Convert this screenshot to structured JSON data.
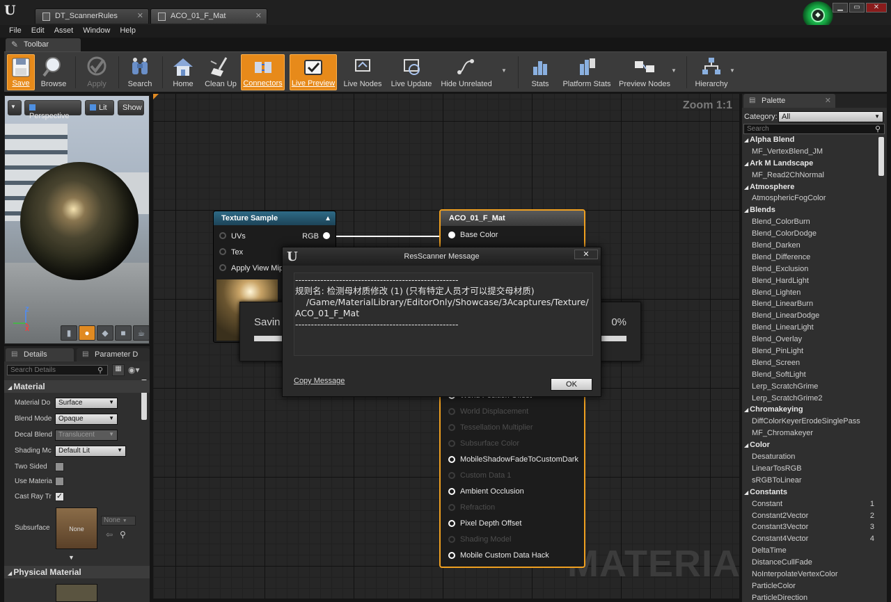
{
  "window": {
    "tabs": [
      {
        "label": "DT_ScannerRules"
      },
      {
        "label": "ACO_01_F_Mat"
      }
    ]
  },
  "menu": [
    "File",
    "Edit",
    "Asset",
    "Window",
    "Help"
  ],
  "toolbar": {
    "tab_label": "Toolbar",
    "buttons": {
      "save": "Save",
      "browse": "Browse",
      "apply": "Apply",
      "search": "Search",
      "home": "Home",
      "clean_up": "Clean Up",
      "connectors": "Connectors",
      "live_preview": "Live Preview",
      "live_nodes": "Live Nodes",
      "live_update": "Live Update",
      "hide_unrelated": "Hide Unrelated",
      "stats": "Stats",
      "platform_stats": "Platform Stats",
      "preview_nodes": "Preview Nodes",
      "hierarchy": "Hierarchy"
    },
    "active": [
      "save",
      "connectors",
      "live_preview"
    ],
    "accent_color": "#e78a1a"
  },
  "viewport": {
    "view_mode": "Perspective",
    "lighting": "Lit",
    "show": "Show",
    "axes": {
      "z": "Z",
      "x": "X"
    }
  },
  "details": {
    "tabs": [
      "Details",
      "Parameter D"
    ],
    "search_placeholder": "Search Details",
    "section_material": "Material",
    "rows": [
      {
        "label": "Material Do",
        "value": "Surface"
      },
      {
        "label": "Blend Mode",
        "value": "Opaque"
      },
      {
        "label": "Decal Blend",
        "value": "Translucent"
      },
      {
        "label": "Shading Mc",
        "value": "Default Lit"
      },
      {
        "label": "Two Sided",
        "checked": false
      },
      {
        "label": "Use Materia",
        "checked": false
      },
      {
        "label": "Cast Ray Tr",
        "checked": true
      },
      {
        "label": "Subsurface",
        "thumb": "None",
        "combo": "None"
      }
    ],
    "section_physical": "Physical Material"
  },
  "graph": {
    "zoom": "Zoom 1:1",
    "watermark": "MATERIAL",
    "texture_node": {
      "title": "Texture Sample",
      "inputs": [
        "UVs",
        "Tex",
        "Apply View Mip"
      ],
      "output": "RGB"
    },
    "material_node": {
      "title": "ACO_01_F_Mat",
      "pins": [
        {
          "label": "Base Color",
          "state": "connected"
        },
        {
          "label": "World Position Offset",
          "state": "on"
        },
        {
          "label": "World Displacement",
          "state": "dim"
        },
        {
          "label": "Tessellation Multiplier",
          "state": "dim"
        },
        {
          "label": "Subsurface Color",
          "state": "dim"
        },
        {
          "label": "MobileShadowFadeToCustomDark",
          "state": "on"
        },
        {
          "label": "Custom Data 1",
          "state": "dim"
        },
        {
          "label": "Ambient Occlusion",
          "state": "on"
        },
        {
          "label": "Refraction",
          "state": "dim"
        },
        {
          "label": "Pixel Depth Offset",
          "state": "on"
        },
        {
          "label": "Shading Model",
          "state": "dim"
        },
        {
          "label": "Mobile Custom Data Hack",
          "state": "on"
        }
      ]
    },
    "saving": {
      "text": "Savin",
      "percent": "0%"
    }
  },
  "dialog": {
    "title": "ResScanner Message",
    "body": "----------------------------------------------------\n规则名: 检测母材质修改 (1) (只有特定人员才可以提交母材质)\n    /Game/MaterialLibrary/EditorOnly/Showcase/3Acaptures/Texture/\nACO_01_F_Mat\n----------------------------------------------------",
    "copy_label": "Copy Message",
    "ok_label": "OK"
  },
  "palette": {
    "tab": "Palette",
    "category_label": "Category:",
    "category_value": "All",
    "search_placeholder": "Search",
    "items": [
      {
        "type": "cat",
        "label": "Alpha Blend"
      },
      {
        "type": "leaf",
        "label": "MF_VertexBlend_JM"
      },
      {
        "type": "cat",
        "label": "Ark M Landscape"
      },
      {
        "type": "leaf",
        "label": "MF_Read2ChNormal"
      },
      {
        "type": "cat",
        "label": "Atmosphere"
      },
      {
        "type": "leaf",
        "label": "AtmosphericFogColor"
      },
      {
        "type": "cat",
        "label": "Blends"
      },
      {
        "type": "leaf",
        "label": "Blend_ColorBurn"
      },
      {
        "type": "leaf",
        "label": "Blend_ColorDodge"
      },
      {
        "type": "leaf",
        "label": "Blend_Darken"
      },
      {
        "type": "leaf",
        "label": "Blend_Difference"
      },
      {
        "type": "leaf",
        "label": "Blend_Exclusion"
      },
      {
        "type": "leaf",
        "label": "Blend_HardLight"
      },
      {
        "type": "leaf",
        "label": "Blend_Lighten"
      },
      {
        "type": "leaf",
        "label": "Blend_LinearBurn"
      },
      {
        "type": "leaf",
        "label": "Blend_LinearDodge"
      },
      {
        "type": "leaf",
        "label": "Blend_LinearLight"
      },
      {
        "type": "leaf",
        "label": "Blend_Overlay"
      },
      {
        "type": "leaf",
        "label": "Blend_PinLight"
      },
      {
        "type": "leaf",
        "label": "Blend_Screen"
      },
      {
        "type": "leaf",
        "label": "Blend_SoftLight"
      },
      {
        "type": "leaf",
        "label": "Lerp_ScratchGrime"
      },
      {
        "type": "leaf",
        "label": "Lerp_ScratchGrime2"
      },
      {
        "type": "cat",
        "label": "Chromakeying"
      },
      {
        "type": "leaf",
        "label": "DiffColorKeyerErodeSinglePass"
      },
      {
        "type": "leaf",
        "label": "MF_Chromakeyer"
      },
      {
        "type": "cat",
        "label": "Color"
      },
      {
        "type": "leaf",
        "label": "Desaturation"
      },
      {
        "type": "leaf",
        "label": "LinearTosRGB"
      },
      {
        "type": "leaf",
        "label": "sRGBToLinear"
      },
      {
        "type": "cat",
        "label": "Constants"
      },
      {
        "type": "leaf",
        "label": "Constant",
        "hotkey": "1"
      },
      {
        "type": "leaf",
        "label": "Constant2Vector",
        "hotkey": "2"
      },
      {
        "type": "leaf",
        "label": "Constant3Vector",
        "hotkey": "3"
      },
      {
        "type": "leaf",
        "label": "Constant4Vector",
        "hotkey": "4"
      },
      {
        "type": "leaf",
        "label": "DeltaTime"
      },
      {
        "type": "leaf",
        "label": "DistanceCullFade"
      },
      {
        "type": "leaf",
        "label": "NoInterpolateVertexColor"
      },
      {
        "type": "leaf",
        "label": "ParticleColor"
      },
      {
        "type": "leaf",
        "label": "ParticleDirection"
      }
    ]
  }
}
